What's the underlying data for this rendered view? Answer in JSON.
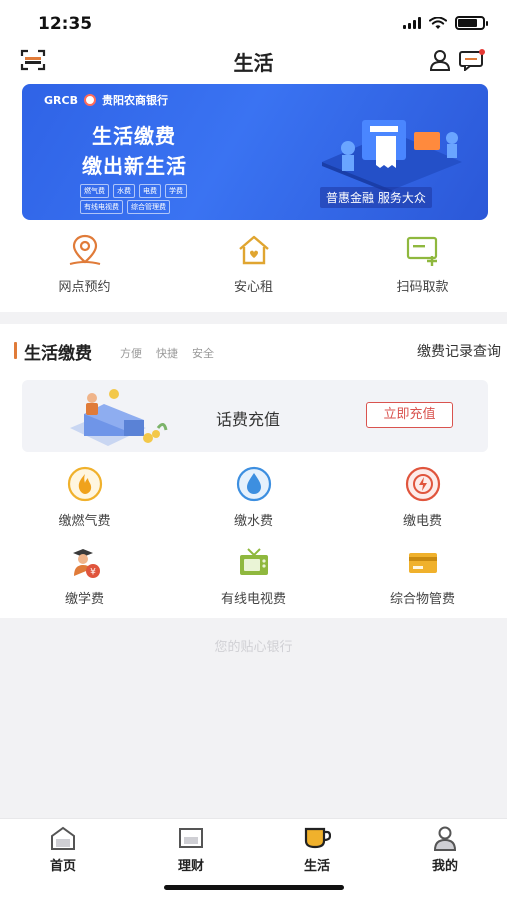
{
  "status_bar": {
    "time": "12:35"
  },
  "nav": {
    "title": "生活",
    "icons": [
      "scan-icon",
      "user-icon",
      "message-icon"
    ]
  },
  "banner": {
    "bank_abbr": "GRCB",
    "bank_name": "贵阳农商银行",
    "headline_1": "生活缴费",
    "headline_2": "缴出新生活",
    "tags": [
      "燃气费",
      "水费",
      "电费",
      "学费",
      "有线电视费",
      "综合管理费"
    ],
    "slogan": "普惠金融 服务大众"
  },
  "quick_actions": [
    {
      "label": "网点预约",
      "icon": "map-pin-icon"
    },
    {
      "label": "安心租",
      "icon": "house-icon"
    },
    {
      "label": "扫码取款",
      "icon": "scan-withdraw-icon"
    }
  ],
  "life_section": {
    "title": "生活缴费",
    "subtitles": [
      "方便",
      "快捷",
      "安全"
    ],
    "record_link": "缴费记录查询",
    "topup": {
      "label": "话费充值",
      "button": "立即充值"
    },
    "items": [
      {
        "label": "缴燃气费",
        "icon": "flame-icon"
      },
      {
        "label": "缴水费",
        "icon": "water-drop-icon"
      },
      {
        "label": "缴电费",
        "icon": "lightning-icon"
      },
      {
        "label": "缴学费",
        "icon": "graduate-icon"
      },
      {
        "label": "有线电视费",
        "icon": "tv-icon"
      },
      {
        "label": "综合物管费",
        "icon": "card-icon"
      }
    ]
  },
  "watermark": "您的贴心银行",
  "tabs": [
    {
      "label": "首页",
      "icon": "home-icon"
    },
    {
      "label": "理财",
      "icon": "wealth-icon"
    },
    {
      "label": "生活",
      "icon": "cup-icon"
    },
    {
      "label": "我的",
      "icon": "profile-icon"
    }
  ],
  "colors": {
    "accent": "#e07b39",
    "banner_blue": "#3a73f2",
    "danger": "#d9534f"
  }
}
